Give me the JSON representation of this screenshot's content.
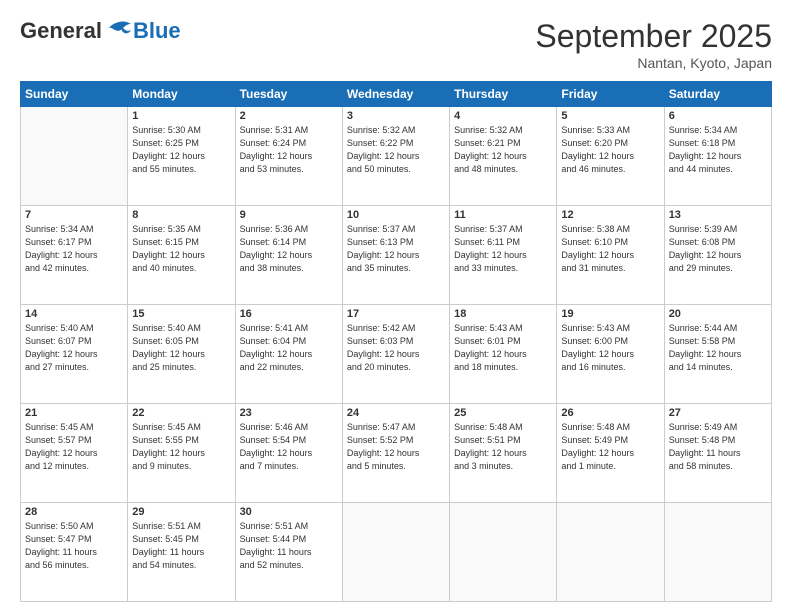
{
  "header": {
    "logo_general": "General",
    "logo_blue": "Blue",
    "month_title": "September 2025",
    "location": "Nantan, Kyoto, Japan"
  },
  "days_of_week": [
    "Sunday",
    "Monday",
    "Tuesday",
    "Wednesday",
    "Thursday",
    "Friday",
    "Saturday"
  ],
  "weeks": [
    [
      {
        "day": "",
        "info": ""
      },
      {
        "day": "1",
        "info": "Sunrise: 5:30 AM\nSunset: 6:25 PM\nDaylight: 12 hours\nand 55 minutes."
      },
      {
        "day": "2",
        "info": "Sunrise: 5:31 AM\nSunset: 6:24 PM\nDaylight: 12 hours\nand 53 minutes."
      },
      {
        "day": "3",
        "info": "Sunrise: 5:32 AM\nSunset: 6:22 PM\nDaylight: 12 hours\nand 50 minutes."
      },
      {
        "day": "4",
        "info": "Sunrise: 5:32 AM\nSunset: 6:21 PM\nDaylight: 12 hours\nand 48 minutes."
      },
      {
        "day": "5",
        "info": "Sunrise: 5:33 AM\nSunset: 6:20 PM\nDaylight: 12 hours\nand 46 minutes."
      },
      {
        "day": "6",
        "info": "Sunrise: 5:34 AM\nSunset: 6:18 PM\nDaylight: 12 hours\nand 44 minutes."
      }
    ],
    [
      {
        "day": "7",
        "info": "Sunrise: 5:34 AM\nSunset: 6:17 PM\nDaylight: 12 hours\nand 42 minutes."
      },
      {
        "day": "8",
        "info": "Sunrise: 5:35 AM\nSunset: 6:15 PM\nDaylight: 12 hours\nand 40 minutes."
      },
      {
        "day": "9",
        "info": "Sunrise: 5:36 AM\nSunset: 6:14 PM\nDaylight: 12 hours\nand 38 minutes."
      },
      {
        "day": "10",
        "info": "Sunrise: 5:37 AM\nSunset: 6:13 PM\nDaylight: 12 hours\nand 35 minutes."
      },
      {
        "day": "11",
        "info": "Sunrise: 5:37 AM\nSunset: 6:11 PM\nDaylight: 12 hours\nand 33 minutes."
      },
      {
        "day": "12",
        "info": "Sunrise: 5:38 AM\nSunset: 6:10 PM\nDaylight: 12 hours\nand 31 minutes."
      },
      {
        "day": "13",
        "info": "Sunrise: 5:39 AM\nSunset: 6:08 PM\nDaylight: 12 hours\nand 29 minutes."
      }
    ],
    [
      {
        "day": "14",
        "info": "Sunrise: 5:40 AM\nSunset: 6:07 PM\nDaylight: 12 hours\nand 27 minutes."
      },
      {
        "day": "15",
        "info": "Sunrise: 5:40 AM\nSunset: 6:05 PM\nDaylight: 12 hours\nand 25 minutes."
      },
      {
        "day": "16",
        "info": "Sunrise: 5:41 AM\nSunset: 6:04 PM\nDaylight: 12 hours\nand 22 minutes."
      },
      {
        "day": "17",
        "info": "Sunrise: 5:42 AM\nSunset: 6:03 PM\nDaylight: 12 hours\nand 20 minutes."
      },
      {
        "day": "18",
        "info": "Sunrise: 5:43 AM\nSunset: 6:01 PM\nDaylight: 12 hours\nand 18 minutes."
      },
      {
        "day": "19",
        "info": "Sunrise: 5:43 AM\nSunset: 6:00 PM\nDaylight: 12 hours\nand 16 minutes."
      },
      {
        "day": "20",
        "info": "Sunrise: 5:44 AM\nSunset: 5:58 PM\nDaylight: 12 hours\nand 14 minutes."
      }
    ],
    [
      {
        "day": "21",
        "info": "Sunrise: 5:45 AM\nSunset: 5:57 PM\nDaylight: 12 hours\nand 12 minutes."
      },
      {
        "day": "22",
        "info": "Sunrise: 5:45 AM\nSunset: 5:55 PM\nDaylight: 12 hours\nand 9 minutes."
      },
      {
        "day": "23",
        "info": "Sunrise: 5:46 AM\nSunset: 5:54 PM\nDaylight: 12 hours\nand 7 minutes."
      },
      {
        "day": "24",
        "info": "Sunrise: 5:47 AM\nSunset: 5:52 PM\nDaylight: 12 hours\nand 5 minutes."
      },
      {
        "day": "25",
        "info": "Sunrise: 5:48 AM\nSunset: 5:51 PM\nDaylight: 12 hours\nand 3 minutes."
      },
      {
        "day": "26",
        "info": "Sunrise: 5:48 AM\nSunset: 5:49 PM\nDaylight: 12 hours\nand 1 minute."
      },
      {
        "day": "27",
        "info": "Sunrise: 5:49 AM\nSunset: 5:48 PM\nDaylight: 11 hours\nand 58 minutes."
      }
    ],
    [
      {
        "day": "28",
        "info": "Sunrise: 5:50 AM\nSunset: 5:47 PM\nDaylight: 11 hours\nand 56 minutes."
      },
      {
        "day": "29",
        "info": "Sunrise: 5:51 AM\nSunset: 5:45 PM\nDaylight: 11 hours\nand 54 minutes."
      },
      {
        "day": "30",
        "info": "Sunrise: 5:51 AM\nSunset: 5:44 PM\nDaylight: 11 hours\nand 52 minutes."
      },
      {
        "day": "",
        "info": ""
      },
      {
        "day": "",
        "info": ""
      },
      {
        "day": "",
        "info": ""
      },
      {
        "day": "",
        "info": ""
      }
    ]
  ]
}
